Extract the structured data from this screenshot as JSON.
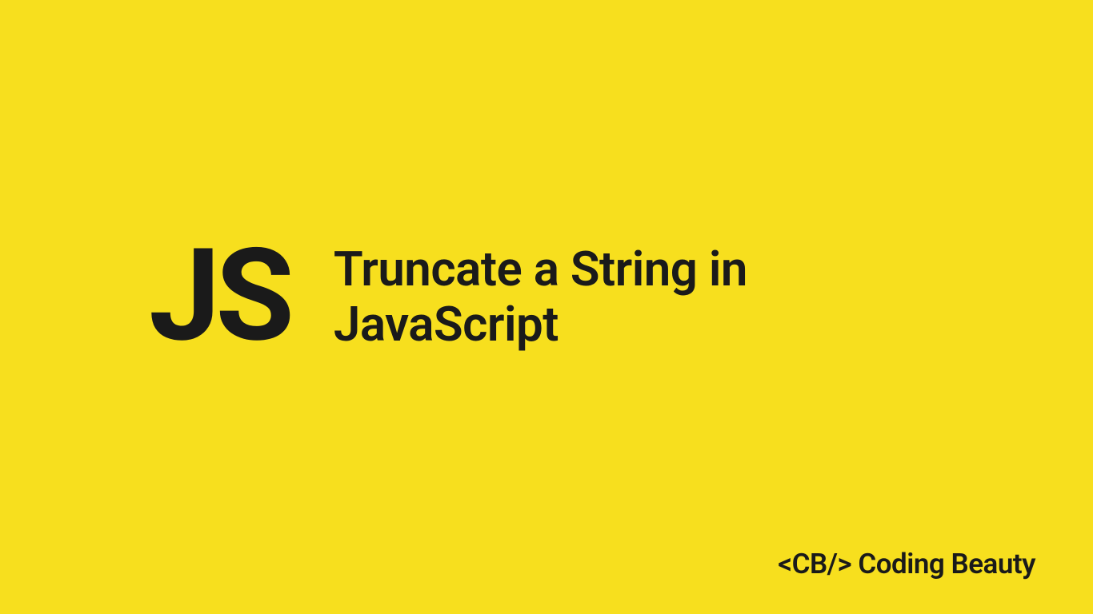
{
  "logo": {
    "text": "JS"
  },
  "heading": {
    "line1": "Truncate a String in",
    "line2": "JavaScript"
  },
  "branding": {
    "tag": "<CB/>",
    "name": "Coding Beauty"
  },
  "colors": {
    "background": "#f7df1e",
    "text": "#1a1a1a"
  }
}
